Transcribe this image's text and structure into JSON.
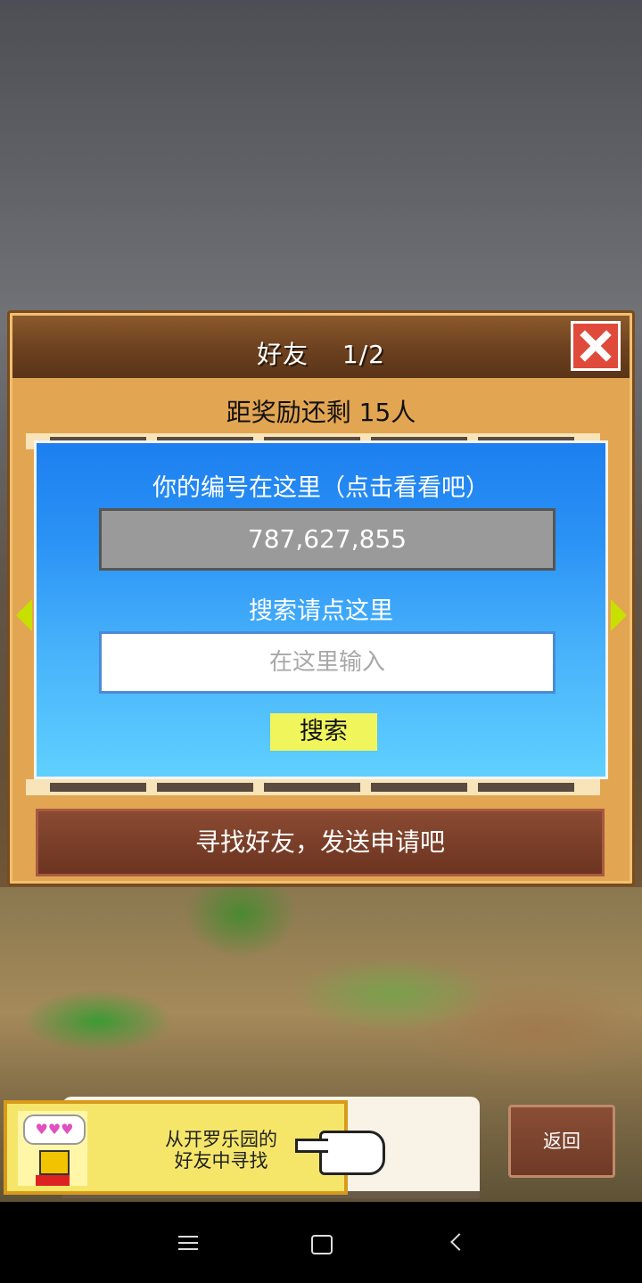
{
  "dialog": {
    "title": "好友",
    "page": "1/2",
    "reward_text": "距奖励还剩 15人",
    "id_caption": "你的编号在这里（点击看看吧）",
    "player_id": "787,627,855",
    "search_caption": "搜索请点这里",
    "search_placeholder": "在这里输入",
    "search_button": "搜索",
    "find_friends_button": "寻找好友，发送申请吧"
  },
  "banner": {
    "hearts": "♥♥♥",
    "line1": "从开罗乐园的",
    "line2": "好友中寻找"
  },
  "back_button": "返回",
  "colors": {
    "panel": "#e2a552",
    "title_bar": "#6e4220",
    "close": "#e04a3a",
    "blue_box": "#2b93f5",
    "search_button": "#f0f55c",
    "brown_button": "#7a3e28"
  }
}
